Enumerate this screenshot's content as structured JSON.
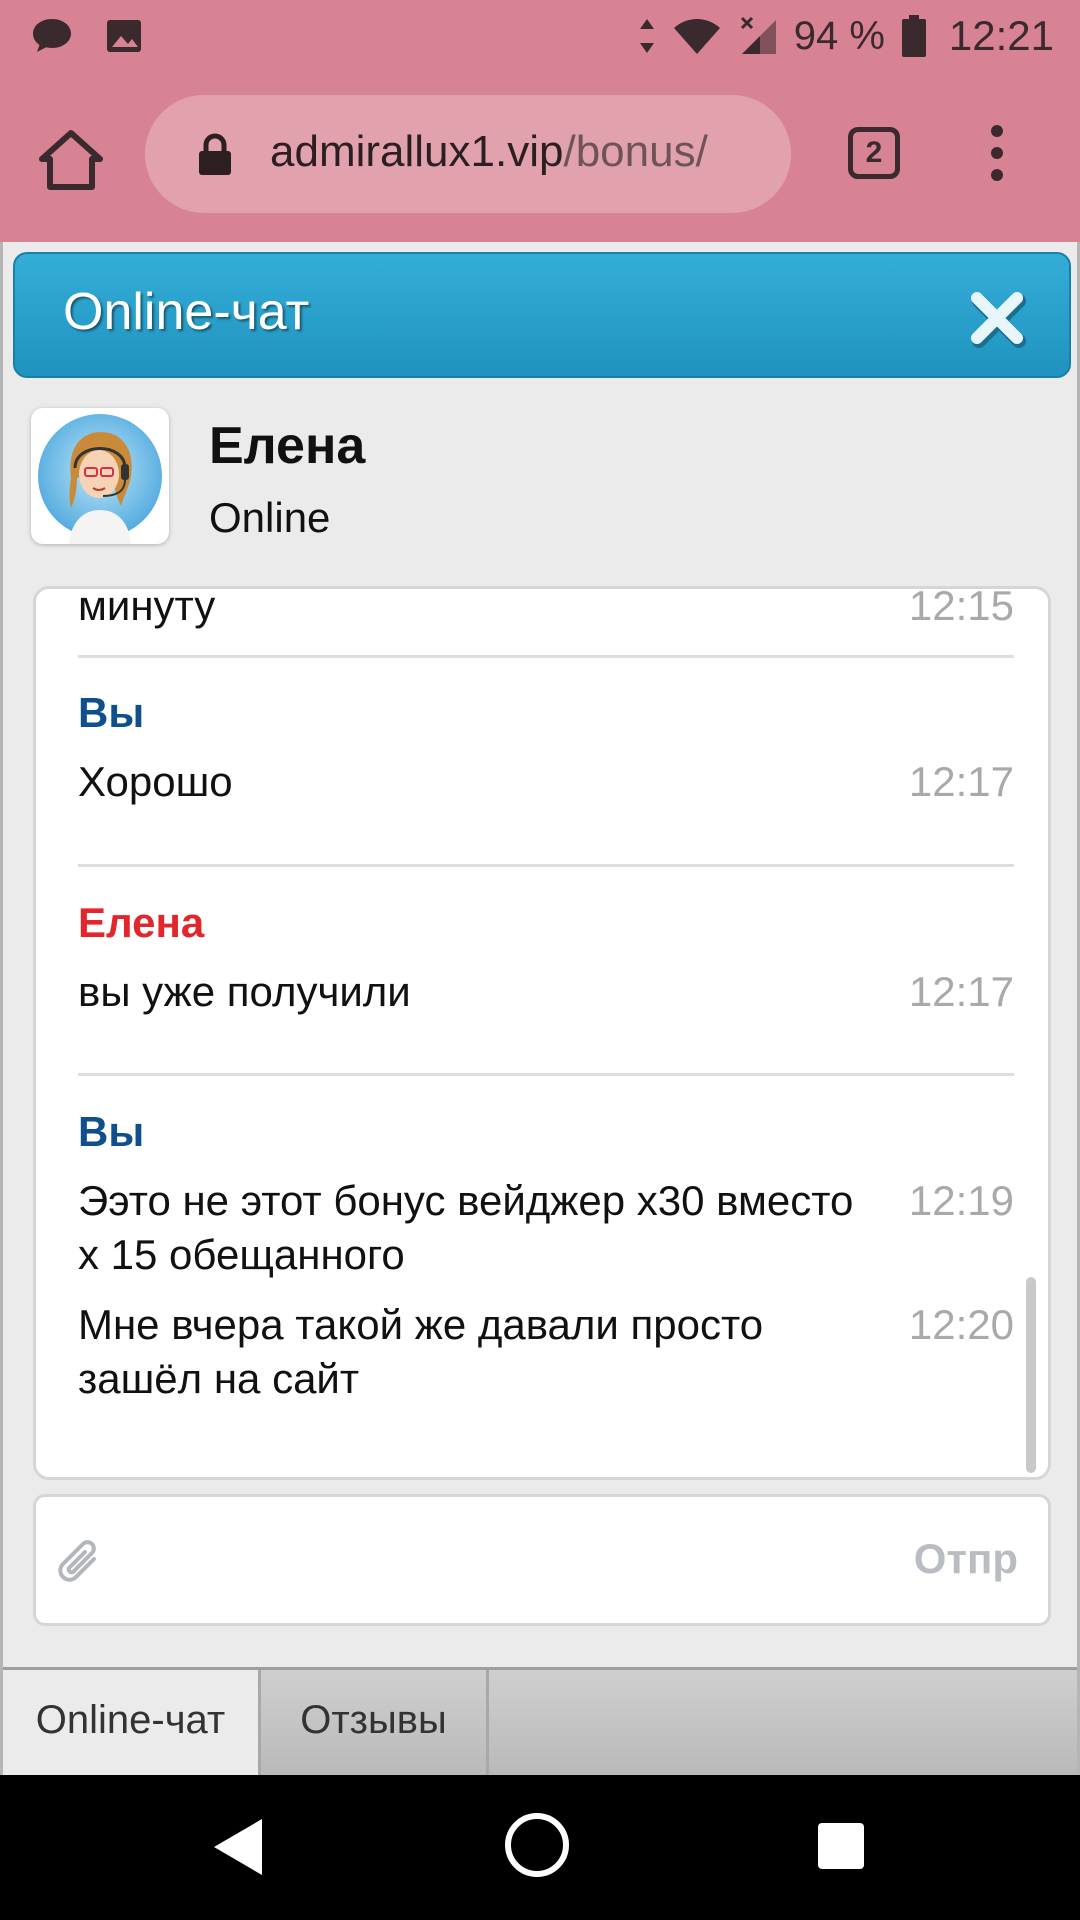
{
  "status_bar": {
    "battery": "94 %",
    "time": "12:21",
    "icons": [
      "message-icon",
      "image-icon",
      "data-arrows-icon",
      "wifi-icon",
      "signal-icon",
      "battery-icon"
    ]
  },
  "browser": {
    "url_domain": "admirallux1.vip",
    "url_path": "/bonus/",
    "tab_count": "2"
  },
  "chat": {
    "title": "Online-чат",
    "agent_name": "Елена",
    "agent_status": "Online",
    "send_label": "Отпр",
    "messages": [
      {
        "sender": "",
        "lines": [
          {
            "text": "минуту",
            "time": "12:15"
          }
        ]
      },
      {
        "sender": "Вы",
        "lines": [
          {
            "text": "Хорошо",
            "time": "12:17"
          }
        ]
      },
      {
        "sender": "Елена",
        "lines": [
          {
            "text": "вы уже получили",
            "time": "12:17"
          }
        ]
      },
      {
        "sender": "Вы",
        "lines": [
          {
            "text": "Ээто не этот бонус вейджер x30 вместо x 15 обещанного",
            "time": "12:19"
          },
          {
            "text": "Мне вчера такой же давали просто зашёл на сайт",
            "time": "12:20"
          }
        ]
      }
    ]
  },
  "bottom_tabs": {
    "chat": "Online-чат",
    "reviews": "Отзывы"
  },
  "colors": {
    "header": "#2ea6d1",
    "you_sender": "#0e4f8c",
    "agent_sender": "#e3262b",
    "browser_bar": "#d88393"
  }
}
